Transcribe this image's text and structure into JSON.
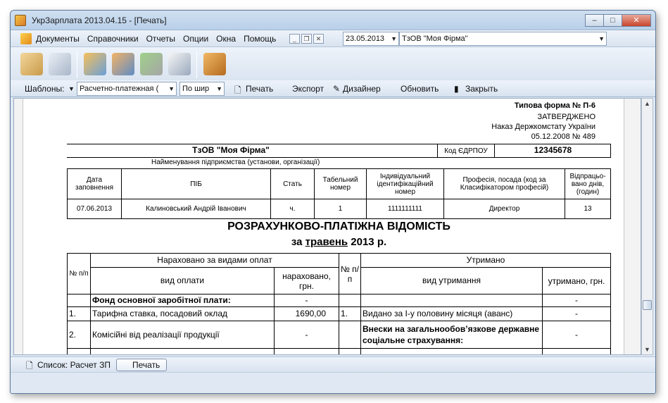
{
  "window": {
    "title": "УкрЗарплата 2013.04.15 - [Печать]"
  },
  "window_buttons": {
    "minimize": "–",
    "maximize": "□",
    "close": "✕"
  },
  "menu": [
    "Документы",
    "Справочники",
    "Отчеты",
    "Опции",
    "Окна",
    "Помощь"
  ],
  "mdi_buttons": [
    "_",
    "❐",
    "✕"
  ],
  "date_field": {
    "value": "23.05.2013"
  },
  "company_field": {
    "value": "ТзОВ \"Моя Фірма\""
  },
  "toolbar2": {
    "templates_label": "Шаблоны:",
    "template_value": "Расчетно-платежная (",
    "fit_value": "По шир",
    "print": "Печать",
    "export": "Экспорт",
    "designer": "Дизайнер",
    "refresh": "Обновить",
    "close": "Закрыть"
  },
  "document": {
    "form_no": "Типова форма № П-6",
    "approved": "ЗАТВЕРДЖЕНО",
    "order_line": "Наказ Держкомстату України",
    "order_date": "05.12.2008  № 489",
    "company": "ТзОВ \"Моя Фірма\"",
    "edrpou_label": "Код ЄДРПОУ",
    "edrpou": "12345678",
    "company_caption": "Найменування підприємства (установи, організації)",
    "emp_headers": [
      "Дата заповнення",
      "ПІБ",
      "Стать",
      "Табельний номер",
      "Індивідуальний ідентифікаційний номер",
      "Професія, посада (код за Класифікатором професій)",
      "Відпрацьо-вано днів, (годин)"
    ],
    "emp_row": [
      "07.06.2013",
      "Калиновський Андрій Іванович",
      "ч.",
      "1",
      "1111111111",
      "Директор",
      "13"
    ],
    "title": "РОЗРАХУНКОВО-ПЛАТІЖНА ВІДОМІСТЬ",
    "period_prefix": "за",
    "period_month": "травень",
    "period_suffix": "2013 р.",
    "pay_header": {
      "no": "№ п/п",
      "accrued_group": "Нараховано за видами оплат",
      "accrued_type": "вид оплати",
      "accrued_amount": "нараховано, грн.",
      "no2": "№ п/п",
      "withheld_group": "Утримано",
      "withheld_type": "вид утримання",
      "withheld_amount": "утримано, грн."
    },
    "pay_rows": [
      {
        "no": "",
        "type": "Фонд основної заробітної плати:",
        "amount": "-",
        "no2": "",
        "wtype": "",
        "wamount": "-"
      },
      {
        "no": "1.",
        "type": "Тарифна ставка, посадовий оклад",
        "amount": "1690,00",
        "no2": "1.",
        "wtype": "Видано за І-у половину місяця (аванс)",
        "wamount": "-"
      },
      {
        "no": "2.",
        "type": "Комісійні від реалізації продукції",
        "amount": "-",
        "no2": "",
        "wtype": "Внески на загальнообов’язкове державне соціальне страхування:",
        "wamount": "-"
      }
    ]
  },
  "status": {
    "list_label": "Список: Расчет ЗП",
    "tab_label": "Печать"
  }
}
